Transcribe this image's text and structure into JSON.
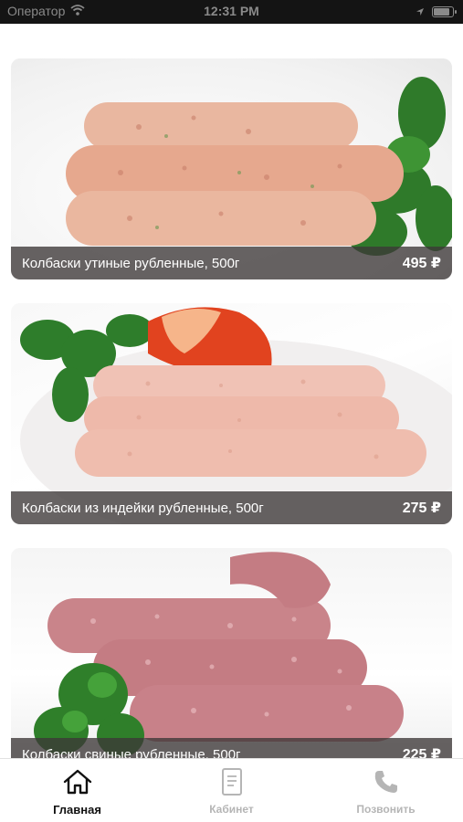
{
  "status_bar": {
    "carrier": "Оператор",
    "time": "12:31 PM",
    "battery_level": 0.9
  },
  "products": [
    {
      "title": "Колбаски утиные рубленные, 500г",
      "price": "495 ₽",
      "image_desc": "duck-sausages"
    },
    {
      "title": "Колбаски из индейки рубленные, 500г",
      "price": "275 ₽",
      "image_desc": "turkey-sausages"
    },
    {
      "title": "Колбаски свиные рубленные, 500г",
      "price": "225 ₽",
      "image_desc": "pork-sausages"
    }
  ],
  "tab_bar": {
    "tabs": [
      {
        "label": "Главная",
        "icon": "home-icon",
        "active": true
      },
      {
        "label": "Кабинет",
        "icon": "document-icon",
        "active": false
      },
      {
        "label": "Позвонить",
        "icon": "phone-icon",
        "active": false
      }
    ]
  },
  "colors": {
    "caption_bg": "#3c3737",
    "active_tab": "#111111",
    "inactive_tab": "#b5b5b5",
    "status_bar_bg": "#141414"
  }
}
